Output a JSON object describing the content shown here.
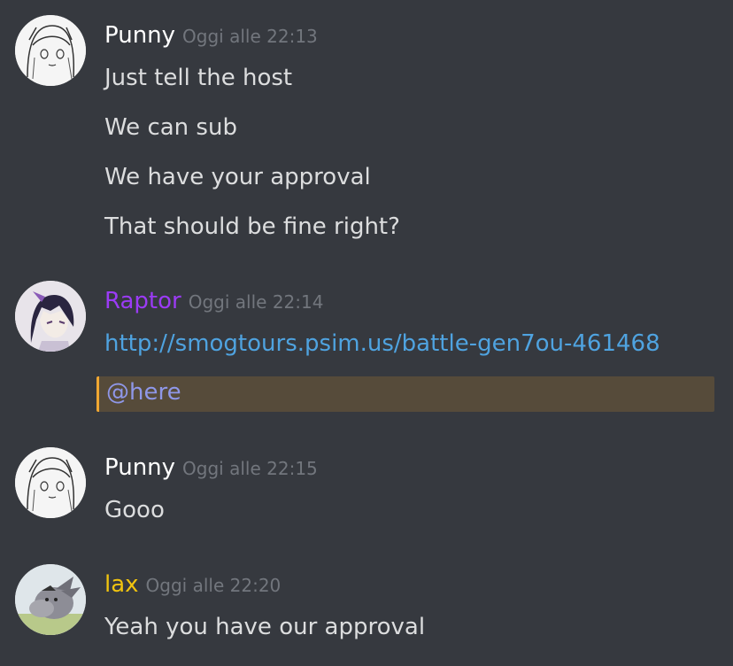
{
  "messages": [
    {
      "author": "Punny",
      "author_color": "#ffffff",
      "timestamp": "Oggi alle 22:13",
      "avatar": "sketch-girl-avatar",
      "lines": [
        "Just tell the host",
        "We can sub",
        "We have your approval",
        "That should be fine right?"
      ]
    },
    {
      "author": "Raptor",
      "author_color": "#9b3bf5",
      "timestamp": "Oggi alle 22:14",
      "avatar": "anime-character-avatar",
      "link": "http://smogtours.psim.us/battle-gen7ou-461468",
      "mention": "@here",
      "mention_highlight_color": "#564b3a"
    },
    {
      "author": "Punny",
      "author_color": "#ffffff",
      "timestamp": "Oggi alle 22:15",
      "avatar": "sketch-girl-avatar",
      "lines": [
        "Gooo"
      ]
    },
    {
      "author": "lax",
      "author_color": "#f1c40f",
      "timestamp": "Oggi alle 22:20",
      "avatar": "eeyore-avatar",
      "lines": [
        "Yeah you have our approval"
      ]
    }
  ]
}
